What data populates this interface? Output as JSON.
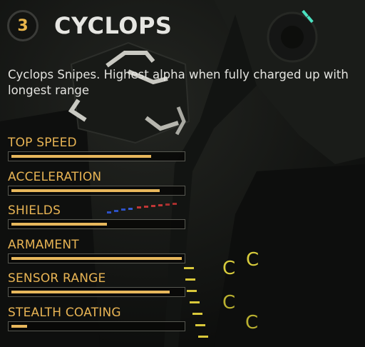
{
  "header": {
    "number": "3",
    "ship_name": "CYCLOPS"
  },
  "description": "Cyclops Snipes. Highest alpha when fully charged up with longest range",
  "stats": [
    {
      "label": "TOP SPEED",
      "value": 0.82
    },
    {
      "label": "ACCELERATION",
      "value": 0.87
    },
    {
      "label": "SHIELDS",
      "value": 0.56
    },
    {
      "label": "ARMAMENT",
      "value": 1.0
    },
    {
      "label": "SENSOR RANGE",
      "value": 0.93
    },
    {
      "label": "STEALTH COATING",
      "value": 0.09
    }
  ],
  "colors": {
    "accent": "#e7b75c",
    "title": "#e6e6e2",
    "background": "#0b0c0b"
  }
}
